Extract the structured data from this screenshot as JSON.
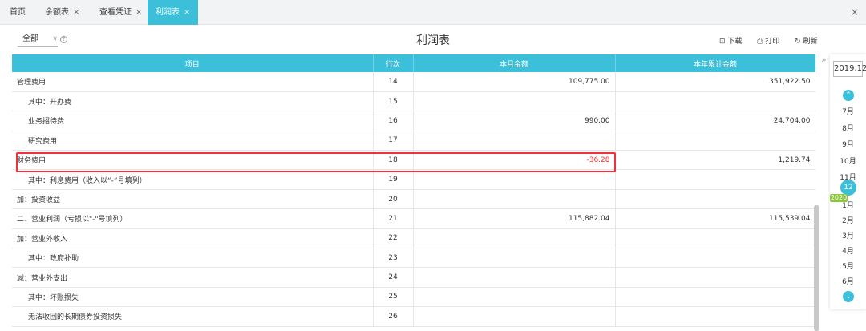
{
  "tabs": [
    {
      "label": "首页",
      "closable": false,
      "active": false
    },
    {
      "label": "余额表",
      "closable": true,
      "active": false
    },
    {
      "label": "查看凭证",
      "closable": true,
      "active": false
    },
    {
      "label": "利润表",
      "closable": true,
      "active": true
    }
  ],
  "close_glyph": "×",
  "toolbar": {
    "scope_label": "全部",
    "title": "利润表",
    "download_label": "下载",
    "print_label": "打印",
    "refresh_label": "刷新"
  },
  "table": {
    "headers": [
      "项目",
      "行次",
      "本月金额",
      "本年累计金额"
    ],
    "rows": [
      {
        "item": "管理费用",
        "line": "14",
        "month": "109,775.00",
        "ytd": "351,922.50",
        "indent": false
      },
      {
        "item": "其中：开办费",
        "line": "15",
        "month": "",
        "ytd": "",
        "indent": true
      },
      {
        "item": "业务招待费",
        "line": "16",
        "month": "990.00",
        "ytd": "24,704.00",
        "indent": true
      },
      {
        "item": "研究费用",
        "line": "17",
        "month": "",
        "ytd": "",
        "indent": true
      },
      {
        "item": "财务费用",
        "line": "18",
        "month": "-36.28",
        "ytd": "1,219.74",
        "indent": false,
        "negative": true
      },
      {
        "item": "其中：利息费用（收入以“-”号填列）",
        "line": "19",
        "month": "",
        "ytd": "",
        "indent": true
      },
      {
        "item": "加：投资收益",
        "line": "20",
        "month": "",
        "ytd": "",
        "indent": false
      },
      {
        "item": "二、营业利润（亏损以\"-\"号填列）",
        "line": "21",
        "month": "115,882.04",
        "ytd": "115,539.04",
        "indent": false
      },
      {
        "item": "加：营业外收入",
        "line": "22",
        "month": "",
        "ytd": "",
        "indent": false
      },
      {
        "item": "其中：政府补助",
        "line": "23",
        "month": "",
        "ytd": "",
        "indent": true
      },
      {
        "item": "减：营业外支出",
        "line": "24",
        "month": "",
        "ytd": "",
        "indent": false
      },
      {
        "item": "其中：坏账损失",
        "line": "25",
        "month": "",
        "ytd": "",
        "indent": true
      },
      {
        "item": "无法收回的长期债券投资损失",
        "line": "26",
        "month": "",
        "ytd": "",
        "indent": true
      }
    ]
  },
  "period": {
    "current": "2019.12",
    "year_tag": "2020",
    "months_before": [
      "7月",
      "8月",
      "9月",
      "10月",
      "11月"
    ],
    "selected": "12月",
    "months_after": [
      "1月",
      "2月",
      "3月",
      "4月",
      "5月",
      "6月"
    ]
  },
  "colors": {
    "accent": "#3cc0d9",
    "negative": "#ff2a2a",
    "highlight": "#f0303a",
    "year_tag": "#8cc63f"
  }
}
